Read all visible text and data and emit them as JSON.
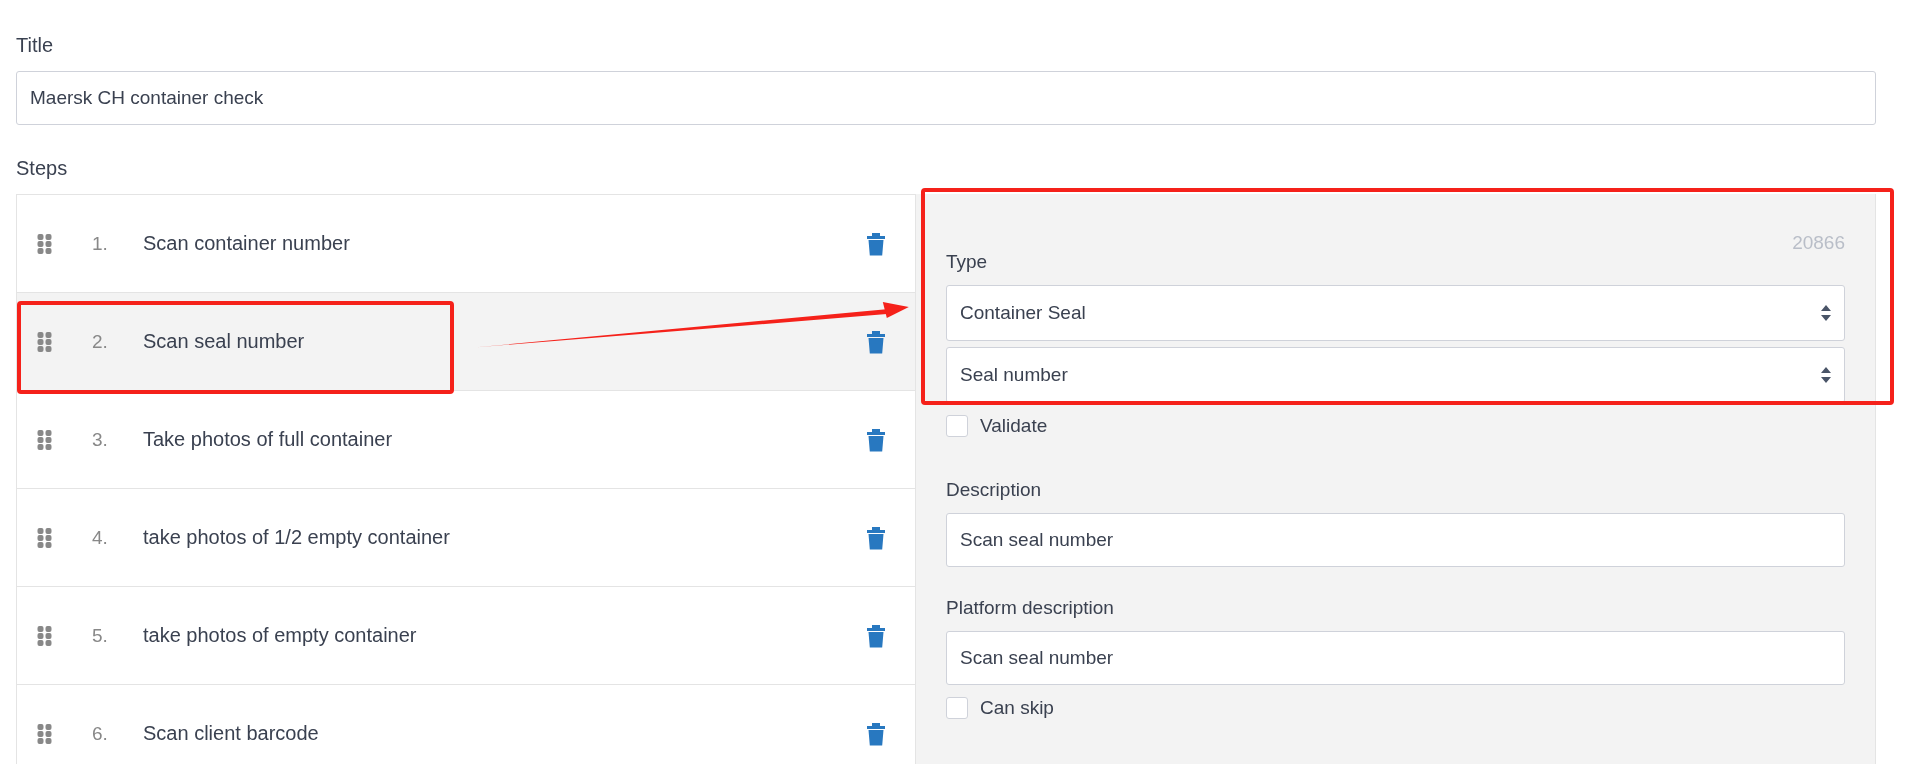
{
  "title_field": {
    "label": "Title",
    "value": "Maersk CH container check"
  },
  "steps": {
    "label": "Steps",
    "items": [
      {
        "number": "1.",
        "text": "Scan container number",
        "selected": false,
        "highlighted": false
      },
      {
        "number": "2.",
        "text": "Scan seal number",
        "selected": true,
        "highlighted": true
      },
      {
        "number": "3.",
        "text": "Take photos of full container",
        "selected": false,
        "highlighted": false
      },
      {
        "number": "4.",
        "text": "take photos of 1/2 empty container",
        "selected": false,
        "highlighted": false
      },
      {
        "number": "5.",
        "text": "take photos of empty container",
        "selected": false,
        "highlighted": false
      },
      {
        "number": "6.",
        "text": "Scan client barcode",
        "selected": false,
        "highlighted": false
      }
    ]
  },
  "step_detail": {
    "type_highlighted": true,
    "id": "20866",
    "type_label": "Type",
    "type_value": "Container Seal",
    "subtype_value": "Seal number",
    "validate": {
      "label": "Validate",
      "checked": false
    },
    "description": {
      "label": "Description",
      "value": "Scan seal number"
    },
    "platform_description": {
      "label": "Platform description",
      "value": "Scan seal number"
    },
    "can_skip": {
      "label": "Can skip",
      "checked": false
    }
  },
  "annotation_arrow": true
}
